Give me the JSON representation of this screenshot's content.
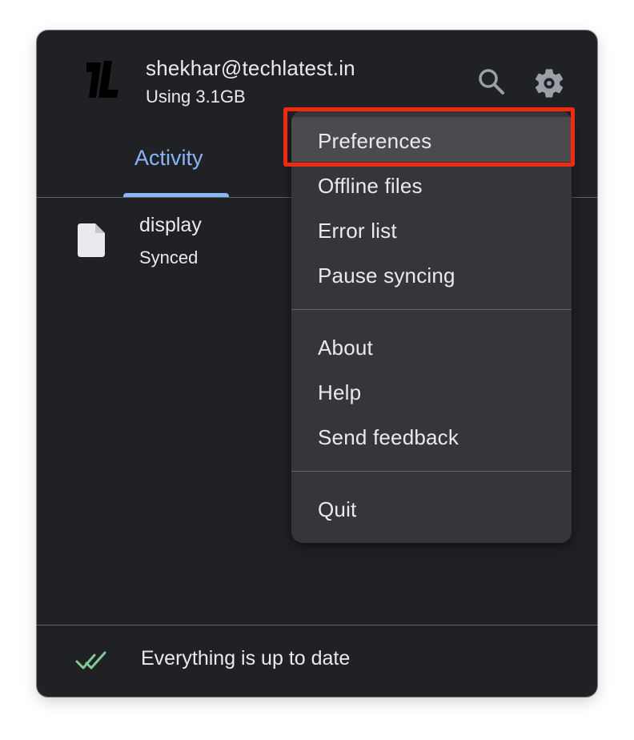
{
  "account": {
    "email": "shekhar@techlatest.in",
    "usage": "Using 3.1GB",
    "logo_icon": "techlatest-logo-icon"
  },
  "header": {
    "search_icon": "search-icon",
    "settings_icon": "gear-icon"
  },
  "tabs": [
    {
      "label": "Activity",
      "selected": true
    }
  ],
  "activity": [
    {
      "name": "display",
      "status": "Synced",
      "icon": "file-icon"
    }
  ],
  "footer": {
    "status": "Everything is up to date",
    "icon": "double-check-icon"
  },
  "menu": {
    "groups": [
      {
        "items": [
          {
            "label": "Preferences",
            "highlighted": true
          },
          {
            "label": "Offline files"
          },
          {
            "label": "Error list"
          },
          {
            "label": "Pause syncing"
          }
        ]
      },
      {
        "items": [
          {
            "label": "About"
          },
          {
            "label": "Help"
          },
          {
            "label": "Send feedback"
          }
        ]
      },
      {
        "items": [
          {
            "label": "Quit"
          }
        ]
      }
    ]
  },
  "colors": {
    "panel_bg": "#202124",
    "menu_bg": "#35363a",
    "accent": "#8ab4f8",
    "highlight_border": "#ee2b12",
    "success": "#81c995"
  }
}
